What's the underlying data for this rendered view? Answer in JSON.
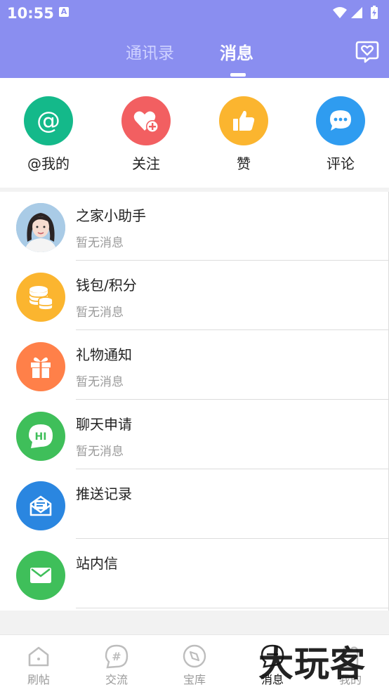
{
  "status_bar": {
    "time": "10:55",
    "notification_letter": "A"
  },
  "header": {
    "tabs": [
      {
        "label": "通讯录"
      },
      {
        "label": "消息"
      }
    ]
  },
  "quick_actions": [
    {
      "label": "@我的",
      "color": "#14b98a",
      "icon": "at-icon"
    },
    {
      "label": "关注",
      "color": "#f25f61",
      "icon": "heart-plus-icon"
    },
    {
      "label": "赞",
      "color": "#fbb52f",
      "icon": "thumbs-up-icon"
    },
    {
      "label": "评论",
      "color": "#2f9cf0",
      "icon": "chat-bubble-icon"
    }
  ],
  "messages": [
    {
      "title": "之家小助手",
      "subtitle": "暂无消息",
      "icon": "assistant-avatar"
    },
    {
      "title": "钱包/积分",
      "subtitle": "暂无消息",
      "icon": "coins-icon",
      "color": "#fbb52f"
    },
    {
      "title": "礼物通知",
      "subtitle": "暂无消息",
      "icon": "gift-icon",
      "color": "#ff8049"
    },
    {
      "title": "聊天申请",
      "subtitle": "暂无消息",
      "icon": "hi-chat-icon",
      "color": "#3fbf5a",
      "badge": "HI"
    },
    {
      "title": "推送记录",
      "subtitle": "",
      "icon": "push-mail-icon",
      "color": "#2a86e0"
    },
    {
      "title": "站内信",
      "subtitle": "",
      "icon": "envelope-icon",
      "color": "#3fbf5a"
    }
  ],
  "bottom_nav": [
    {
      "label": "刷帖",
      "icon": "home-icon"
    },
    {
      "label": "交流",
      "icon": "hashtag-icon"
    },
    {
      "label": "宝库",
      "icon": "compass-icon"
    },
    {
      "label": "消息",
      "icon": "message-icon"
    },
    {
      "label": "我的",
      "icon": "profile-icon"
    }
  ],
  "watermark": "大玩客"
}
